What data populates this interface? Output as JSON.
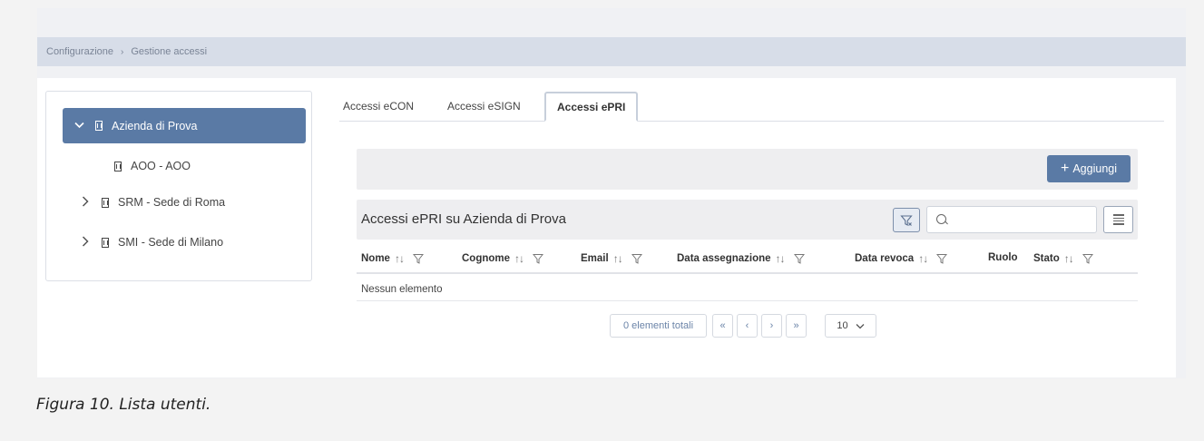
{
  "breadcrumb": {
    "parent": "Configurazione",
    "separator": "›",
    "current": "Gestione accessi"
  },
  "tree": {
    "root": {
      "label": "Azienda di Prova",
      "expanded": true
    },
    "children": [
      {
        "label": "AOO - AOO",
        "expandable": false
      },
      {
        "label": "SRM - Sede di Roma",
        "expandable": true
      },
      {
        "label": "SMI - Sede di Milano",
        "expandable": true
      }
    ]
  },
  "tabs": [
    {
      "label": "Accessi eCON",
      "active": false
    },
    {
      "label": "Accessi eSIGN",
      "active": false
    },
    {
      "label": "Accessi ePRI",
      "active": true
    }
  ],
  "toolbar": {
    "add_label": "Aggiungi"
  },
  "table": {
    "title": "Accessi ePRI su Azienda di Prova",
    "search_value": "",
    "columns": [
      {
        "label": "Nome",
        "sortable": true,
        "filterable": true
      },
      {
        "label": "Cognome",
        "sortable": true,
        "filterable": true
      },
      {
        "label": "Email",
        "sortable": true,
        "filterable": true
      },
      {
        "label": "Data assegnazione",
        "sortable": true,
        "filterable": true
      },
      {
        "label": "Data revoca",
        "sortable": true,
        "filterable": true
      },
      {
        "label": "Ruolo",
        "sortable": false,
        "filterable": false
      },
      {
        "label": "Stato",
        "sortable": true,
        "filterable": true
      }
    ],
    "sort_glyph": "↑↓",
    "empty_text": "Nessun elemento"
  },
  "pager": {
    "total_text": "0 elementi totali",
    "first": "«",
    "prev": "‹",
    "next": "›",
    "last": "»",
    "page_size": "10"
  },
  "caption": "Figura 10. Lista utenti.",
  "colors": {
    "accent": "#5a7aa5",
    "breadcrumb_bg": "#d7dde8",
    "panel_bg": "#eeeef0"
  }
}
